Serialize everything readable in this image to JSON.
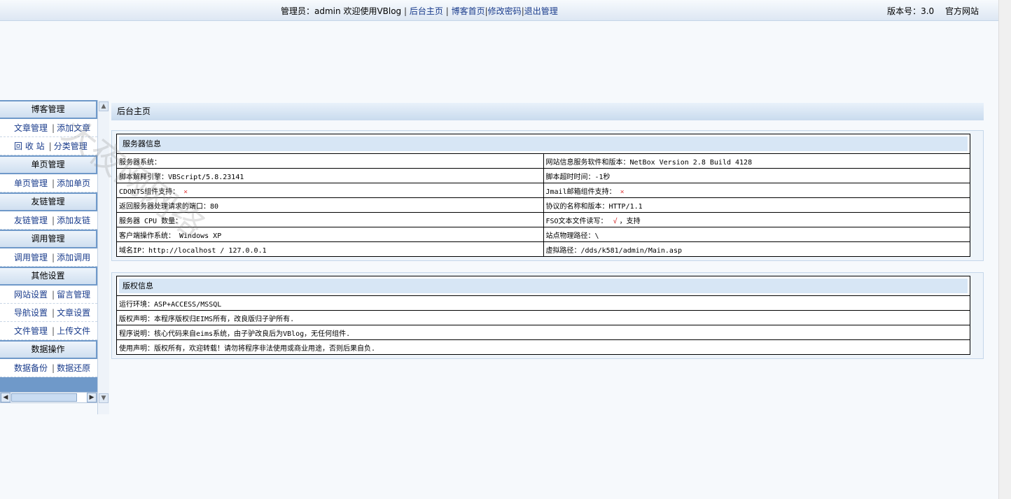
{
  "topbar": {
    "admin_prefix": "管理员：",
    "admin_name": "admin",
    "welcome": " 欢迎使用VBlog",
    "links": [
      "后台主页",
      "博客首页",
      "修改密码",
      "退出管理"
    ],
    "version": "版本号：3.0",
    "official": "官方网站"
  },
  "sidebar": {
    "groups": [
      {
        "title": "博客管理",
        "rows": [
          [
            "文章管理",
            "添加文章"
          ],
          [
            "回 收 站",
            "分类管理"
          ]
        ]
      },
      {
        "title": "单页管理",
        "rows": [
          [
            "单页管理",
            "添加单页"
          ]
        ]
      },
      {
        "title": "友链管理",
        "rows": [
          [
            "友链管理",
            "添加友链"
          ]
        ]
      },
      {
        "title": "调用管理",
        "rows": [
          [
            "调用管理",
            "添加调用"
          ]
        ]
      },
      {
        "title": "其他设置",
        "rows": [
          [
            "网站设置",
            "留言管理"
          ],
          [
            "导航设置",
            "文章设置"
          ],
          [
            "文件管理",
            "上传文件"
          ]
        ]
      },
      {
        "title": "数据操作",
        "rows": [
          [
            "数据备份",
            "数据还原"
          ]
        ]
      }
    ],
    "separator": "|"
  },
  "main": {
    "title": "后台主页",
    "server": {
      "header": "服务器信息",
      "rows": [
        [
          "服务器系统：",
          "网站信息服务软件和版本：NetBox Version 2.8 Build 4128"
        ],
        [
          "脚本解释引擎：VBScript/5.8.23141",
          "脚本超时时间：-1秒"
        ],
        [
          "CDONTS组件支持：",
          "Jmail邮箱组件支持："
        ],
        [
          "返回服务器处理请求的端口：80",
          "协议的名称和版本：HTTP/1.1"
        ],
        [
          "服务器 CPU 数量：",
          "FSO文本文件读写："
        ],
        [
          "客户端操作系统： Windows XP",
          "站点物理路径：\\"
        ],
        [
          "域名IP：http://localhost / 127.0.0.1",
          "虚拟路径：/dds/k581/admin/Main.asp"
        ]
      ],
      "cross": "×",
      "check": "√",
      "fso_support": "，支持"
    },
    "copyright": {
      "header": "版权信息",
      "rows": [
        "运行环境：ASP+ACCESS/MSSQL",
        "版权声明：本程序版权归EIMS所有，改良版归子驴所有.",
        "程序说明：核心代码来自eims系统，由子驴改良后为VBlog，无任何组件.",
        "使用声明：版权所有，欢迎转载！请勿将程序非法使用或商业用途，否则后果自负."
      ]
    }
  },
  "watermark": "大夜网网络"
}
